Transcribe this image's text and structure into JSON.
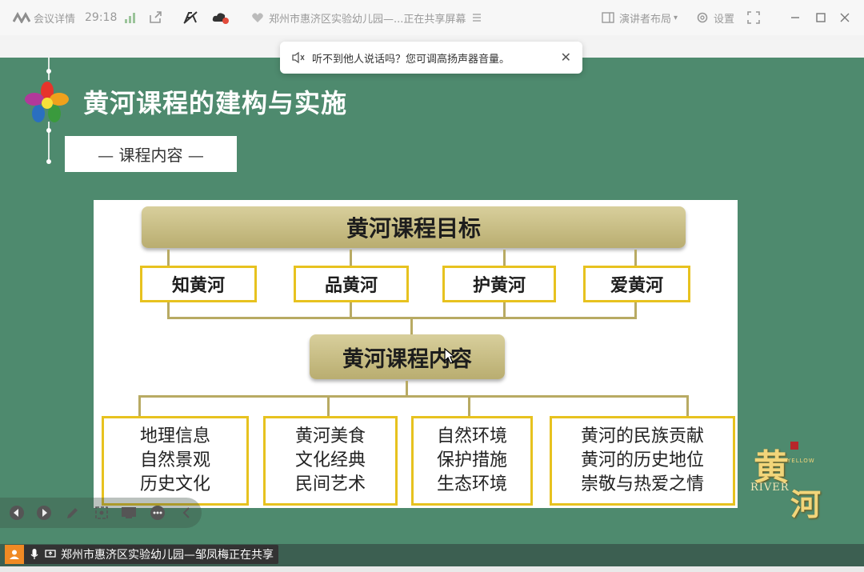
{
  "topbar": {
    "meeting_details": "会议详情",
    "timer": "29:18",
    "sharing_title": "郑州市惠济区实验幼儿园—...正在共享屏幕",
    "presenter_layout": "演讲者布局",
    "settings": "设置"
  },
  "notice": {
    "text": "听不到他人说话吗？您可调高扬声器音量。",
    "close": "✕"
  },
  "slide": {
    "title": "黄河课程的建构与实施",
    "subtitle": "— 课程内容 —",
    "chart": {
      "goal": "黄河课程目标",
      "goals": [
        "知黄河",
        "品黄河",
        "护黄河",
        "爱黄河"
      ],
      "content": "黄河课程内容",
      "details": [
        [
          "地理信息",
          "自然景观",
          "历史文化"
        ],
        [
          "黄河美食",
          "文化经典",
          "民间艺术"
        ],
        [
          "自然环境",
          "保护措施",
          "生态环境"
        ],
        [
          "黄河的民族贡献",
          "黄河的历史地位",
          "崇敬与热爱之情"
        ]
      ]
    },
    "logo": {
      "main": "黄",
      "sub": "河",
      "river": "RIVER",
      "yellow": "YELLOW"
    }
  },
  "footer": {
    "sharing": "郑州市惠济区实验幼儿园—邹凤梅正在共享"
  },
  "colors": {
    "slide_bg": "#4e8a6e",
    "accent_yellow": "#e7c21f",
    "gold_box": "#c8bd83"
  }
}
